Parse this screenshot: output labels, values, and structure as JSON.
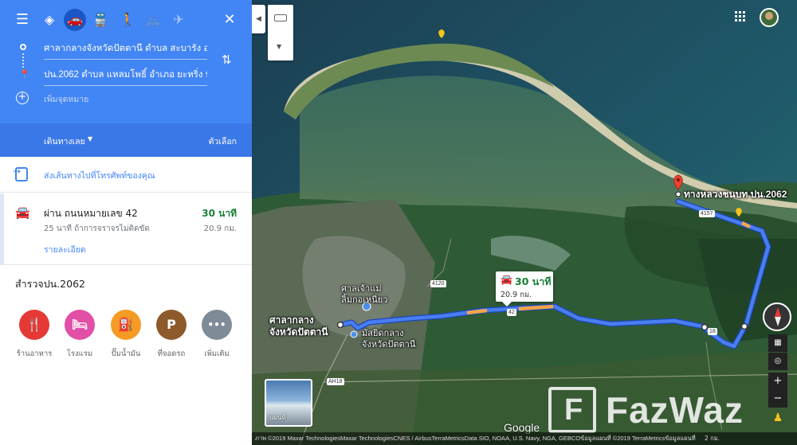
{
  "directions": {
    "origin": "ศาลากลางจังหวัดปัตตานี ตำบล สะบารัง อ",
    "destination": "ปน.2062 ตำบล แหลมโพธิ์ อำเภอ ยะหริ่ง ปั",
    "add_destination": "เพิ่มจุดหมาย",
    "depart_label": "เดินทางเลย",
    "options_label": "ตัวเลือก",
    "send_to_phone": "ส่งเส้นทางไปที่โทรศัพท์ของคุณ"
  },
  "route": {
    "via": "ผ่าน ถนนหมายเลข 42",
    "time": "30 นาที",
    "typical": "25 นาที ถ้าการจราจรไม่ติดขัด",
    "distance": "20.9 กม.",
    "details": "รายละเอียด"
  },
  "explore": {
    "title": "สำรวจปน.2062",
    "categories": [
      {
        "label": "ร้านอาหาร",
        "icon": "restaurant-icon",
        "glyph": "🍴",
        "color": "#e53935"
      },
      {
        "label": "โรงแรม",
        "icon": "hotel-icon",
        "glyph": "🛏",
        "color": "#e14fa6"
      },
      {
        "label": "ปั๊มน้ำมัน",
        "icon": "gas-station-icon",
        "glyph": "⛽",
        "color": "#f59b24"
      },
      {
        "label": "ที่จอดรถ",
        "icon": "parking-icon",
        "glyph": "P",
        "color": "#8d5a2b"
      },
      {
        "label": "เพิ่มเติม",
        "icon": "more-icon",
        "glyph": "•••",
        "color": "#7f8c97"
      }
    ]
  },
  "map": {
    "callout_time": "30 นาที",
    "callout_distance": "20.9 กม.",
    "dest_label": "ทางหลวงชนบท ปน.2062",
    "origin_label_1": "ศาลากลาง",
    "origin_label_2": "จังหวัดปัตตานี",
    "shrine_label_1": "ศาลเจ้าแม่",
    "shrine_label_2": "ลิ้มกอเหนี่ยว",
    "mosque_label_1": "มัสยิดกลาง",
    "mosque_label_2": "จังหวัดปัตตานี",
    "road_4157": "4157",
    "road_4120": "4120",
    "road_42": "42",
    "road_18": "18",
    "road_ah18": "AH18",
    "satellite_label": "แผนที่",
    "google": "Google",
    "attribution": "ภาพ ©2019 Maxar TechnologiesMaxar TechnologiesCNES / AirbusTerraMetricsData SIO, NOAA, U.S. Navy, NGA, GEBCOข้อมูลแผนที่ ©2019 TerraMetricsข้อมูลแผนที่",
    "scale": "2 กม.",
    "watermark": "FazWaz"
  },
  "colors": {
    "header": "#4285f4",
    "route": "#4a7ef0",
    "traffic": "#f5a44a",
    "time_green": "#188038"
  }
}
